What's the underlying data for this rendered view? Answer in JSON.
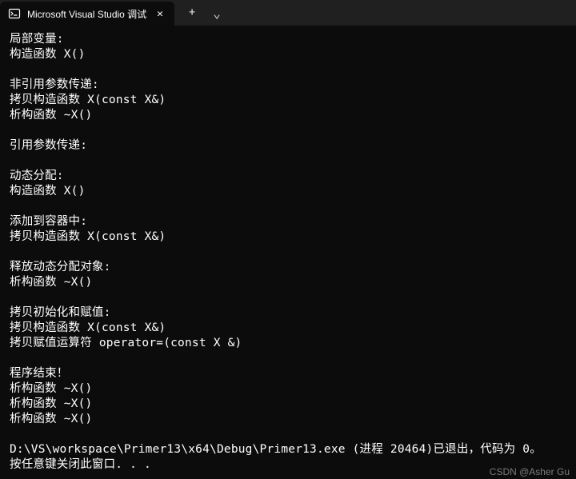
{
  "titleBar": {
    "tab": {
      "title": "Microsoft Visual Studio 调试",
      "closeGlyph": "✕"
    },
    "newTabGlyph": "+",
    "dropdownGlyph": "⌄"
  },
  "terminal": {
    "lines": [
      "局部变量:",
      "构造函数 X()",
      "",
      "非引用参数传递:",
      "拷贝构造函数 X(const X&)",
      "析构函数 ~X()",
      "",
      "引用参数传递:",
      "",
      "动态分配:",
      "构造函数 X()",
      "",
      "添加到容器中:",
      "拷贝构造函数 X(const X&)",
      "",
      "释放动态分配对象:",
      "析构函数 ~X()",
      "",
      "拷贝初始化和赋值:",
      "拷贝构造函数 X(const X&)",
      "拷贝赋值运算符 operator=(const X &)",
      "",
      "程序结束！",
      "析构函数 ~X()",
      "析构函数 ~X()",
      "析构函数 ~X()",
      "",
      "D:\\VS\\workspace\\Primer13\\x64\\Debug\\Primer13.exe (进程 20464)已退出，代码为 0。",
      "按任意键关闭此窗口. . ."
    ]
  },
  "watermark": "CSDN @Asher Gu"
}
